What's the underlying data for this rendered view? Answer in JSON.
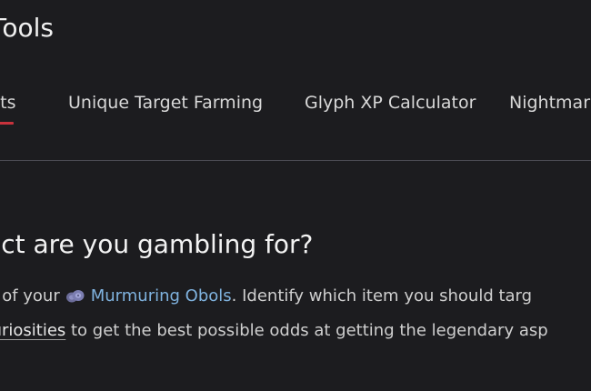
{
  "header": {
    "title_fragment": "Tools"
  },
  "tabs": [
    {
      "label": "ects",
      "active": true
    },
    {
      "label": "Unique Target Farming",
      "active": false
    },
    {
      "label": "Glyph XP Calculator",
      "active": false
    },
    {
      "label": "Nightmar",
      "active": false
    }
  ],
  "colors": {
    "background": "#1c1c1f",
    "active_tab_underline": "#c8323c",
    "link_blue": "#7fb2de"
  },
  "main": {
    "heading": "ect are you gambling for?",
    "line1_prefix": "ut of your",
    "obol_icon": "obol-coins-icon",
    "obols_link": "Murmuring Obols",
    "line1_suffix": ". Identify which item you should targ",
    "curiosities_link": "Curiosities",
    "line2_suffix": " to get the best possible odds at getting the legendary asp",
    "line3": "."
  }
}
